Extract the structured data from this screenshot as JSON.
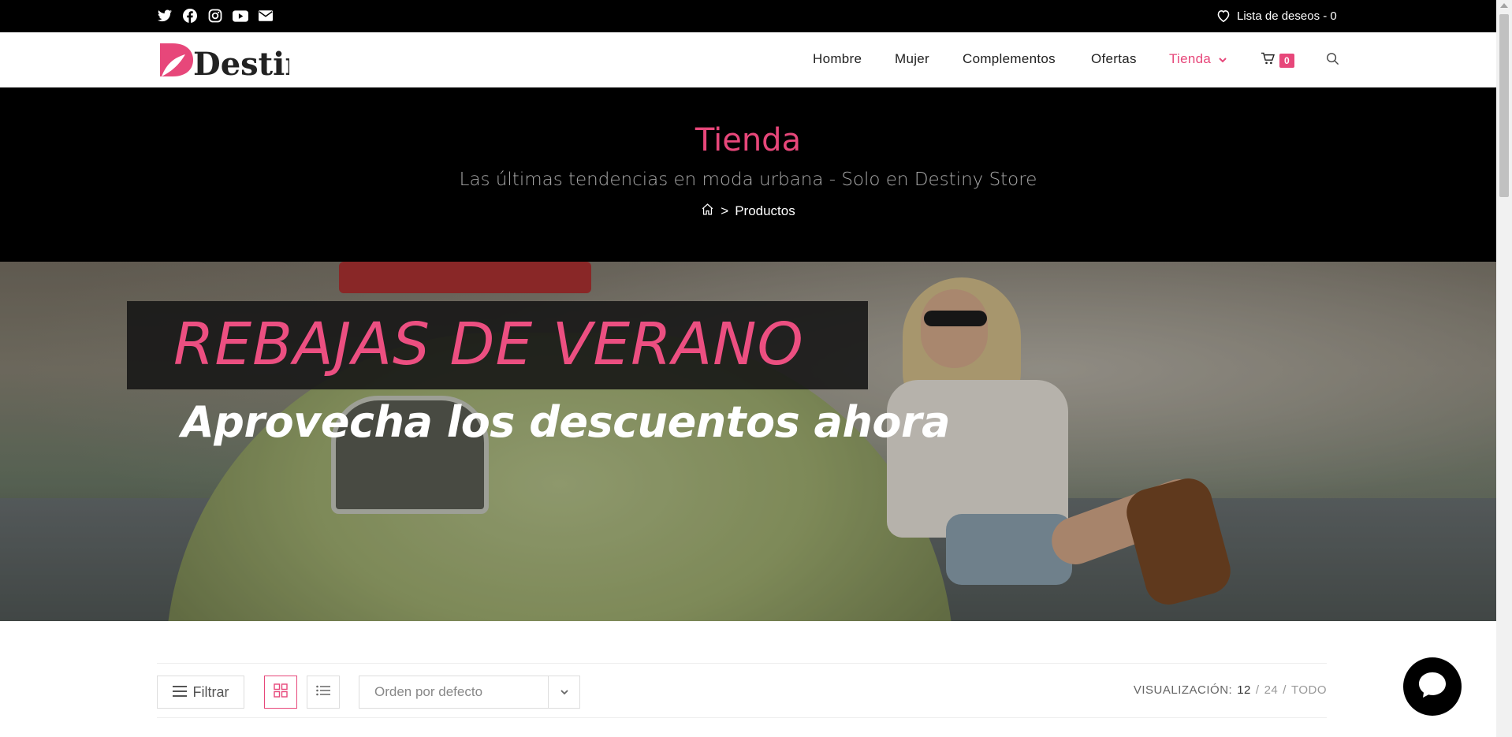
{
  "topbar": {
    "social": [
      "twitter-icon",
      "facebook-icon",
      "instagram-icon",
      "youtube-icon",
      "email-icon"
    ],
    "wishlist_label": "Lista de deseos - 0"
  },
  "header": {
    "logo_text": "Destiny",
    "nav": [
      "Hombre",
      "Mujer",
      "Complementos",
      "Ofertas",
      "Tienda"
    ],
    "active_nav": "Tienda",
    "cart_count": "0"
  },
  "page_header": {
    "title": "Tienda",
    "subtitle": "Las últimas tendencias en moda urbana - Solo en Destiny Store",
    "breadcrumb_sep": ">",
    "breadcrumb_current": "Productos"
  },
  "hero": {
    "title": "REBAJAS DE VERANO",
    "subtitle": "Aprovecha los descuentos ahora"
  },
  "toolbar": {
    "filter_label": "Filtrar",
    "sort_value": "Orden por defecto",
    "visualizacion_label": "VISUALIZACIÓN:",
    "options": [
      "12",
      "24",
      "TODO"
    ],
    "option_sep": "/"
  },
  "colors": {
    "accent": "#e7477a",
    "topbar_bg": "#000000"
  }
}
